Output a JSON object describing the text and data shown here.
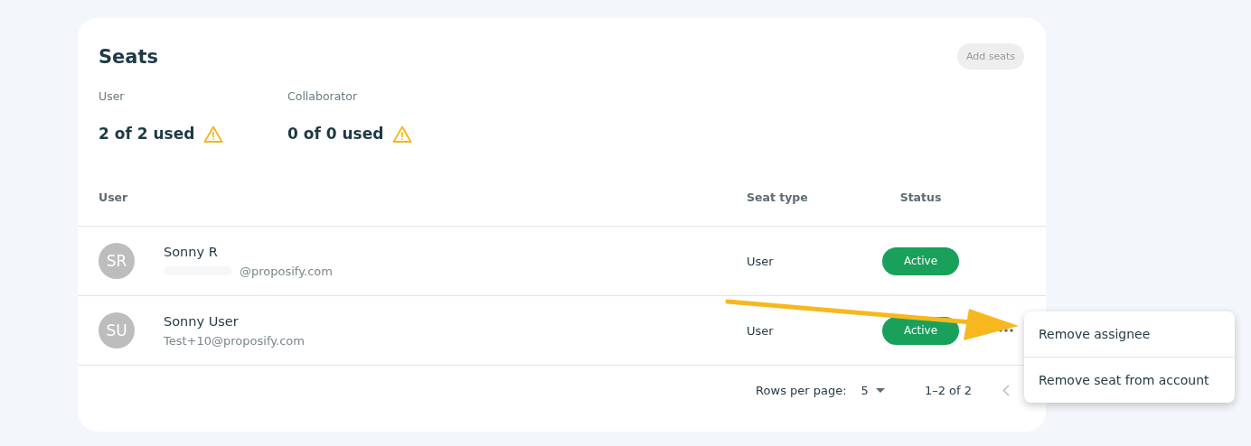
{
  "card": {
    "title": "Seats",
    "add_button": {
      "label": "Add seats",
      "disabled": true
    }
  },
  "summary": [
    {
      "label": "User",
      "value": "2 of 2 used",
      "warning": true
    },
    {
      "label": "Collaborator",
      "value": "0 of 0 used",
      "warning": true
    }
  ],
  "table": {
    "columns": [
      "User",
      "Seat type",
      "Status"
    ],
    "rows": [
      {
        "initials": "SR",
        "name": "Sonny R",
        "email": "@proposify.com",
        "email_redacted": true,
        "seat_type": "User",
        "status": "Active",
        "actions_visible": false
      },
      {
        "initials": "SU",
        "name": "Sonny User",
        "email": "Test+10@proposify.com",
        "email_redacted": false,
        "seat_type": "User",
        "status": "Active",
        "actions_visible": true
      }
    ]
  },
  "pagination": {
    "rows_per_page_label": "Rows per page:",
    "rows_per_page": "5",
    "range": "1–2 of 2"
  },
  "context_menu": {
    "items": [
      "Remove assignee",
      "Remove seat from account"
    ]
  },
  "annotation": {
    "kind": "arrow"
  }
}
